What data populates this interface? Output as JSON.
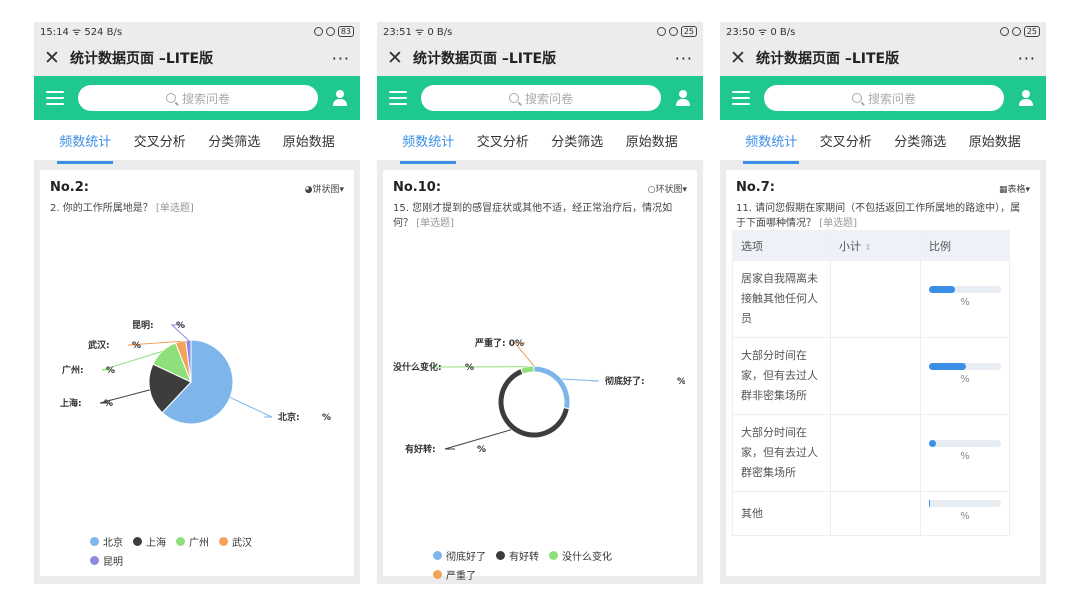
{
  "app": {
    "title": "统计数据页面 –LITE版",
    "search_placeholder": "搜索问卷",
    "tabs": [
      "频数统计",
      "交叉分析",
      "分类筛选",
      "原始数据"
    ]
  },
  "phones": [
    {
      "status": {
        "time": "15:14",
        "net": "524 B/s",
        "battery": "83"
      },
      "question": {
        "no": "No.2:",
        "text": "2. 你的工作所属地是？",
        "type": "[单选题]",
        "chart_type_label": "饼状图▾"
      },
      "chart_data": {
        "type": "pie",
        "categories": [
          "北京",
          "上海",
          "广州",
          "武汉",
          "昆明"
        ],
        "values": [
          62,
          20,
          12,
          4,
          2
        ],
        "colors": [
          "#7eb6ec",
          "#3d3d3d",
          "#8fe07a",
          "#f2a35a",
          "#8a8ae0"
        ],
        "slice_labels": [
          "北京:",
          "上海:",
          "广州:",
          "武汉:",
          "昆明:"
        ],
        "value_suffix": "%"
      }
    },
    {
      "status": {
        "time": "23:51",
        "net": "0 B/s",
        "battery": "25"
      },
      "question": {
        "no": "No.10:",
        "text": "15. 您刚才提到的感冒症状或其他不适，经正常治疗后，情况如何？",
        "type": "[单选题]",
        "chart_type_label": "环状图▾"
      },
      "chart_data": {
        "type": "pie",
        "categories": [
          "彻底好了",
          "有好转",
          "没什么变化",
          "严重了"
        ],
        "values": [
          28,
          66,
          6,
          0
        ],
        "colors": [
          "#7eb6ec",
          "#3d3d3d",
          "#8fe07a",
          "#f2a35a"
        ],
        "slice_labels": [
          "彻底好了:",
          "有好转:",
          "没什么变化:",
          "严重了: 0%"
        ],
        "value_suffix": "%"
      }
    },
    {
      "status": {
        "time": "23:50",
        "net": "0 B/s",
        "battery": "25"
      },
      "question": {
        "no": "No.7:",
        "text": "11. 请问您假期在家期间（不包括返回工作所属地的路途中），属于下面哪种情况？",
        "type": "[单选题]",
        "chart_type_label": "表格▾"
      },
      "table": {
        "headers": [
          "选项",
          "小计",
          "比例"
        ],
        "rows": [
          {
            "option": "居家自我隔离未接触其他任何人员",
            "count": "",
            "pct_text": "%",
            "fraction": 0.36
          },
          {
            "option": "大部分时间在家，但有去过人群非密集场所",
            "count": "",
            "pct_text": "%",
            "fraction": 0.52
          },
          {
            "option": "大部分时间在家，但有去过人群密集场所",
            "count": "",
            "pct_text": "%",
            "fraction": 0.1
          },
          {
            "option": "其他",
            "count": "",
            "pct_text": "%",
            "fraction": 0.02
          }
        ]
      }
    }
  ]
}
